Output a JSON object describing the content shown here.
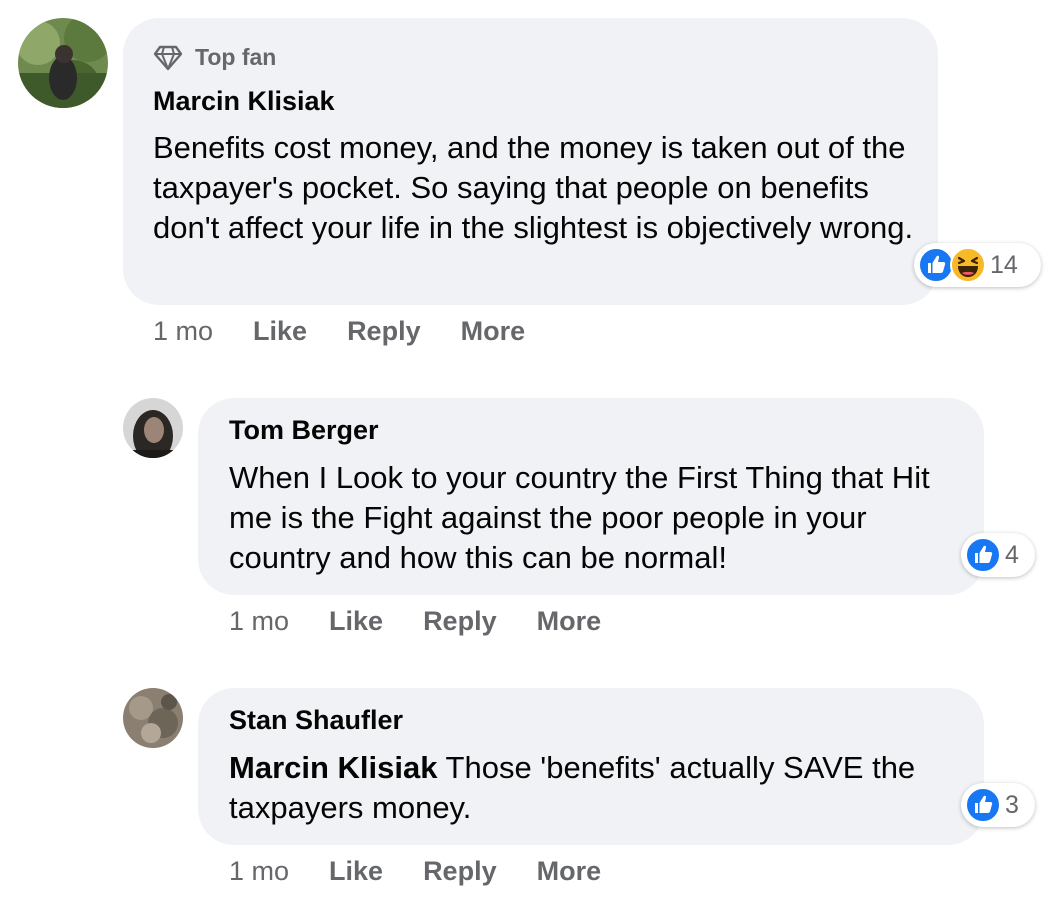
{
  "comments": [
    {
      "badge": "Top fan",
      "author": "Marcin Klisiak",
      "mention": "",
      "text": "Benefits cost money, and the money is taken out of the taxpayer's pocket. So saying that people on benefits don't affect your life in the slightest is objectively wrong.",
      "reaction_count": "14",
      "reactions": [
        "like-icon",
        "haha-icon"
      ],
      "time": "1 mo",
      "like_label": "Like",
      "reply_label": "Reply",
      "more_label": "More"
    },
    {
      "author": "Tom Berger",
      "mention": "",
      "text": "When I Look to your country the First Thing that Hit me is the Fight against the poor people in your country and how this can be normal!",
      "reaction_count": "4",
      "reactions": [
        "like-icon"
      ],
      "time": "1 mo",
      "like_label": "Like",
      "reply_label": "Reply",
      "more_label": "More"
    },
    {
      "author": "Stan Shaufler",
      "mention": "Marcin Klisiak",
      "text": " Those 'benefits' actually SAVE the taxpayers money.",
      "reaction_count": "3",
      "reactions": [
        "like-icon"
      ],
      "time": "1 mo",
      "like_label": "Like",
      "reply_label": "Reply",
      "more_label": "More"
    }
  ],
  "colors": {
    "bubble": "#f0f2f5",
    "meta_text": "#65676b",
    "like_blue": "#1877f2",
    "haha_yellow": "#f7b928"
  }
}
